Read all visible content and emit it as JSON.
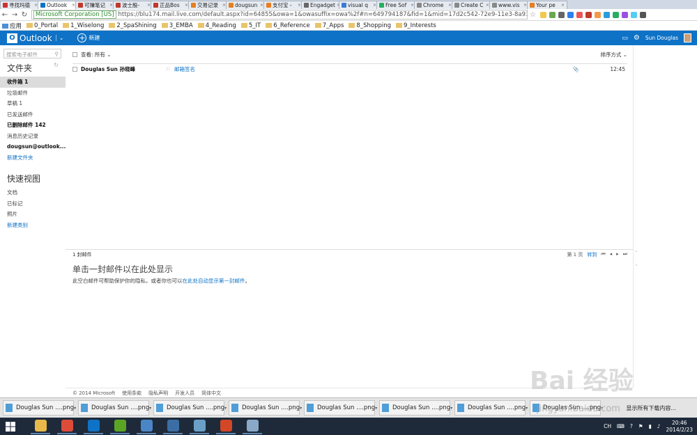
{
  "browser": {
    "tabs": [
      {
        "label": "寻找玛德",
        "color": "#d03030"
      },
      {
        "label": "Outlook",
        "color": "#0e72c6",
        "active": true
      },
      {
        "label": "可赚笔记",
        "color": "#c0392b"
      },
      {
        "label": "波士股-",
        "color": "#c0392b"
      },
      {
        "label": "正品Bos",
        "color": "#c0392b"
      },
      {
        "label": "交易记录",
        "color": "#e67e22"
      },
      {
        "label": "dougsun",
        "color": "#e67e22"
      },
      {
        "label": "支付宝 -",
        "color": "#e67e22"
      },
      {
        "label": "Engadget",
        "color": "#666666"
      },
      {
        "label": "visual q",
        "color": "#3a7bd5"
      },
      {
        "label": "Free Sof",
        "color": "#27ae60"
      },
      {
        "label": "Chrome",
        "color": "#888888"
      },
      {
        "label": "Create C",
        "color": "#888888"
      },
      {
        "label": "www.vis",
        "color": "#888888"
      },
      {
        "label": "Your pe",
        "color": "#e67e22"
      }
    ],
    "ev_label": "Microsoft Corporation [US]",
    "url": "https://blu174.mail.live.com/default.aspx?id=64855&owa=1&owasuffix=owa%2f#n=649794187&fid=1&mid=17d2c542-72e9-11e3-8a93-00237de4b074",
    "bookmarks": [
      "应用",
      "0_Portal",
      "1_Wiselong",
      "2_SpaShining",
      "3_EMBA",
      "4_Reading",
      "5_IT",
      "6_Reference",
      "7_Apps",
      "8_Shopping",
      "9_Interests"
    ]
  },
  "outlook": {
    "brand": "Outlook",
    "new_label": "新建",
    "user": "Sun Douglas",
    "search_placeholder": "搜索电子邮件",
    "folders_title": "文件夹",
    "folders": [
      {
        "label": "收件箱  1",
        "style": "sel"
      },
      {
        "label": "垃圾邮件",
        "style": ""
      },
      {
        "label": "草稿  1",
        "style": ""
      },
      {
        "label": "已发送邮件",
        "style": ""
      },
      {
        "label": "已删除邮件  142",
        "style": "bold"
      },
      {
        "label": "消息历史记录",
        "style": ""
      },
      {
        "label": "dougsun@outlook....",
        "style": "bold"
      },
      {
        "label": "新建文件夹",
        "style": "link"
      }
    ],
    "quickviews_title": "快速视图",
    "quickviews": [
      {
        "label": "文档",
        "style": ""
      },
      {
        "label": "已标记",
        "style": ""
      },
      {
        "label": "照片",
        "style": ""
      },
      {
        "label": "新建类别",
        "style": "link"
      }
    ],
    "list": {
      "view_label": "查看: 所有 ⌄",
      "sort_label": "排序方式 ⌄",
      "messages": [
        {
          "from": "Douglas Sun 孙晓峰",
          "subject": "邮箱签名",
          "time": "12:45"
        }
      ],
      "count_label": "1 封邮件",
      "page_label": "第 1 页",
      "goto_label": "转到"
    },
    "reading": {
      "title": "单击一封邮件以在此处显示",
      "text_before": "此空白邮件可帮助保护你的隐私，或者你也可以",
      "link": "在此处自动显示第一封邮件",
      "text_after": "。"
    },
    "footer": [
      "© 2014 Microsoft",
      "使用条款",
      "隐私声明",
      "开发人员",
      "简体中文"
    ]
  },
  "downloads": {
    "items": [
      "Douglas Sun ....png",
      "Douglas Sun ....png",
      "Douglas Sun ....png",
      "Douglas Sun ....png",
      "Douglas Sun ....png",
      "Douglas Sun ....png",
      "Douglas Sun ....png",
      "Douglas Sun ....png"
    ],
    "show_all": "显示所有下载内容..."
  },
  "taskbar": {
    "apps": [
      {
        "name": "file-explorer",
        "color": "#e8b84a"
      },
      {
        "name": "chrome",
        "color": "#dd4b39"
      },
      {
        "name": "outlook",
        "color": "#0e72c6"
      },
      {
        "name": "evernote",
        "color": "#5ba525"
      },
      {
        "name": "app-5",
        "color": "#4a86c5"
      },
      {
        "name": "app-6",
        "color": "#3b6ea5"
      },
      {
        "name": "app-7",
        "color": "#6aa0c8"
      },
      {
        "name": "powerpoint",
        "color": "#d24726"
      },
      {
        "name": "app-9",
        "color": "#8aa9c9"
      }
    ],
    "ime": "CH",
    "time": "20:46",
    "date": "2014/2/23"
  },
  "watermark": {
    "text": "Bai 经验",
    "url": "jingyan.baidu.com"
  }
}
